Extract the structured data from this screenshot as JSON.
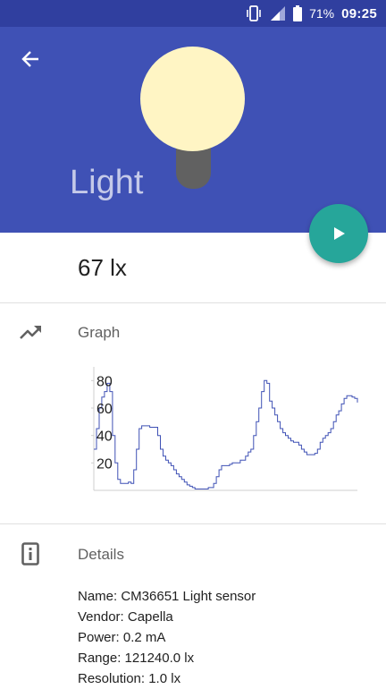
{
  "status_bar": {
    "battery_percent": "71%",
    "time": "09:25",
    "icons": [
      "vibrate-icon",
      "signal-icon",
      "battery-icon"
    ]
  },
  "header": {
    "title": "Light",
    "back_icon": "arrow-back-icon",
    "illustration": "light-bulb",
    "colors": {
      "background": "#3f51b5",
      "bulb": "#fff5c4",
      "bulb_base": "#616161"
    }
  },
  "fab": {
    "icon": "play-icon",
    "color": "#26a69a"
  },
  "reading": {
    "value": "67 lx"
  },
  "graph": {
    "label": "Graph",
    "icon": "trending-up-icon"
  },
  "chart_data": {
    "type": "line",
    "title": "",
    "xlabel": "",
    "ylabel": "",
    "ylim": [
      0,
      90
    ],
    "yticks": [
      "80",
      "60",
      "40",
      "20"
    ],
    "series_color": "#3f51b5",
    "x": [
      0,
      1,
      2,
      3,
      4,
      5,
      6,
      7,
      8,
      9,
      10,
      11,
      12,
      13,
      14,
      15,
      16,
      17,
      18,
      19,
      20,
      21,
      22,
      23,
      24,
      25,
      26,
      27,
      28,
      29,
      30,
      31,
      32,
      33,
      34,
      35,
      36,
      37,
      38,
      39,
      40,
      41,
      42,
      43,
      44,
      45,
      46,
      47,
      48,
      49,
      50,
      51,
      52,
      53,
      54,
      55,
      56,
      57,
      58,
      59,
      60,
      61,
      62,
      63,
      64,
      65,
      66,
      67,
      68,
      69,
      70,
      71,
      72,
      73,
      74,
      75,
      76,
      77,
      78,
      79,
      80,
      81,
      82,
      83,
      84,
      85,
      86,
      87,
      88,
      89,
      90,
      91,
      92,
      93,
      94,
      95,
      96,
      97,
      98,
      99
    ],
    "series": [
      {
        "values": [
          30,
          45,
          60,
          68,
          72,
          78,
          72,
          40,
          20,
          8,
          5,
          5,
          5,
          6,
          5,
          15,
          30,
          45,
          47,
          47,
          47,
          46,
          46,
          46,
          40,
          30,
          25,
          22,
          20,
          18,
          15,
          12,
          10,
          8,
          6,
          4,
          3,
          2,
          1,
          1,
          1,
          1,
          1,
          2,
          2,
          5,
          10,
          15,
          18,
          18,
          18,
          19,
          20,
          20,
          20,
          22,
          22,
          25,
          28,
          30,
          40,
          50,
          60,
          72,
          80,
          78,
          65,
          60,
          55,
          50,
          45,
          42,
          40,
          38,
          36,
          35,
          35,
          33,
          30,
          28,
          26,
          26,
          26,
          27,
          30,
          35,
          38,
          40,
          42,
          45,
          50,
          55,
          58,
          63,
          67,
          69,
          69,
          68,
          67,
          64
        ]
      }
    ]
  },
  "details": {
    "label": "Details",
    "icon": "info-device-icon",
    "lines": [
      "Name: CM36651 Light sensor",
      "Vendor: Capella",
      "Power: 0.2 mA",
      "Range: 121240.0 lx",
      "Resolution: 1.0 lx"
    ]
  }
}
